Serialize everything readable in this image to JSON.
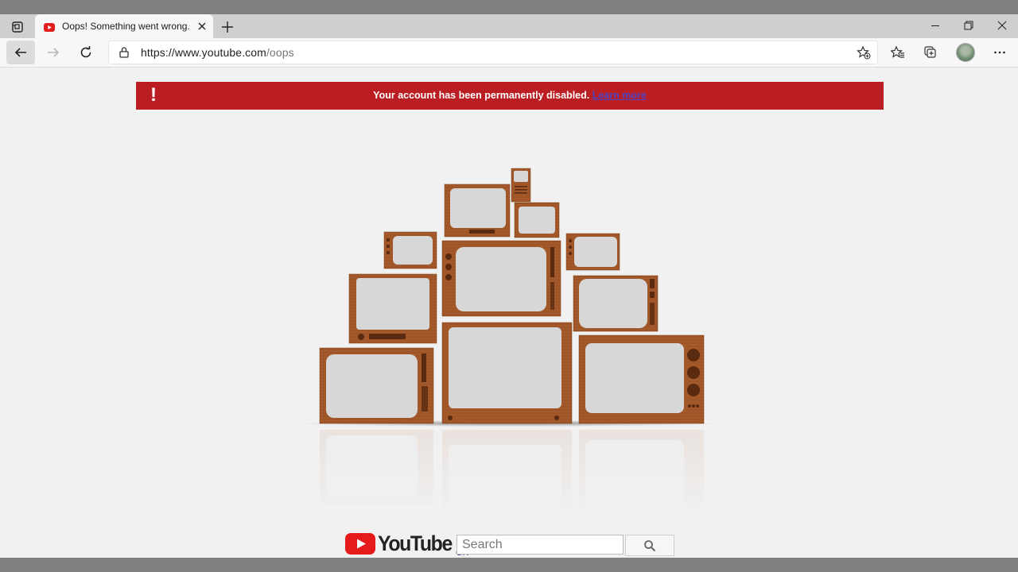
{
  "browser": {
    "tab_title": "Oops! Something went wrong. -",
    "url_host": "https://www.youtube.com",
    "url_path": "/oops",
    "icons": [
      "workspaces-icon",
      "youtube-favicon",
      "close-icon",
      "new-tab-icon",
      "minimize-icon",
      "restore-icon",
      "window-close-icon",
      "back-icon",
      "forward-icon",
      "refresh-icon",
      "lock-icon",
      "add-favorite-icon",
      "favorites-icon",
      "collections-icon",
      "profile-avatar",
      "more-icon"
    ]
  },
  "page": {
    "banner_text": "Your account has been permanently disabled.",
    "banner_link": "Learn more",
    "banner_color": "#bb1e22",
    "logo_text": "YouTube",
    "logo_country": "GR",
    "search_placeholder": "Search"
  }
}
